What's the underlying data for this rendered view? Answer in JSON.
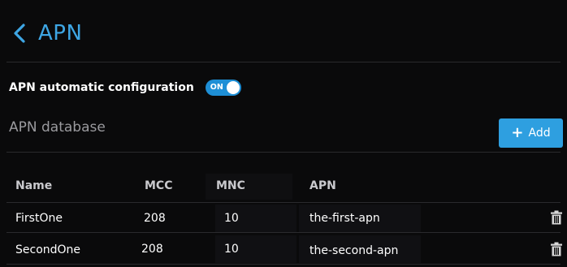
{
  "header": {
    "title": "APN",
    "back_icon": "chevron-left-icon"
  },
  "auto_config": {
    "label": "APN automatic configuration",
    "toggle_text": "ON",
    "enabled": true
  },
  "database": {
    "title": "APN database",
    "add_label": "Add",
    "add_icon": "plus-icon"
  },
  "table": {
    "columns": [
      "Name",
      "MCC",
      "MNC",
      "APN"
    ],
    "rows": [
      {
        "name": "FirstOne",
        "mcc": "208",
        "mnc": "10",
        "apn": "the-first-apn"
      },
      {
        "name": "SecondOne",
        "mcc": "208",
        "mnc": "10",
        "apn": "the-second-apn"
      }
    ],
    "delete_icon": "trash-icon"
  },
  "colors": {
    "accent": "#3ea6e4",
    "button": "#2e9fe0",
    "background": "#0a0a0b"
  }
}
